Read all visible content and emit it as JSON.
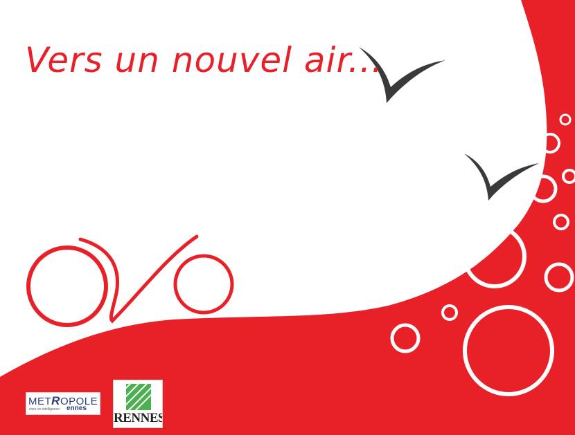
{
  "poster": {
    "tagline": "Vers un nouvel air...",
    "colors": {
      "brand_red": "#e82129",
      "background": "#ffffff",
      "bird": "#3a3a3a",
      "circle_ring": "#ffffff"
    },
    "icons": [
      "bird-icon",
      "bicycle-icon",
      "bubble-circles"
    ]
  },
  "logos": {
    "metropole": {
      "prefix": "MET",
      "rest": "OPOLE",
      "city_suffix": "ennes",
      "motto": "vivre en intelligence"
    },
    "rennes": {
      "wordmark": "RENNES"
    }
  }
}
